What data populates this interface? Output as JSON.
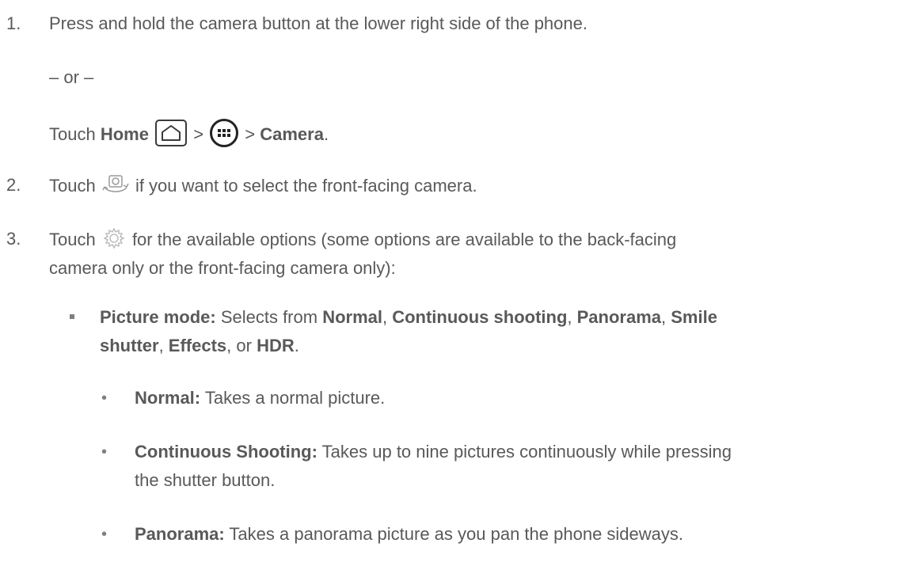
{
  "step1": {
    "num": "1.",
    "text": "Press and hold the camera button at the lower right side of the phone.",
    "or": "– or –",
    "touch": "Touch ",
    "home": "Home",
    "gt1": " > ",
    "gt2": " > ",
    "camera": "Camera",
    "period": "."
  },
  "step2": {
    "num": "2.",
    "touch": "Touch ",
    "rest": " if you want to select the front-facing camera."
  },
  "step3": {
    "num": "3.",
    "touch": "Touch ",
    "rest": " for the available options (some options are available to the back-facing",
    "line2": "camera only or the front-facing camera only):"
  },
  "picture_mode": {
    "label": "Picture mode:",
    "text1": " Selects from ",
    "normal": "Normal",
    "c1": ", ",
    "continuous": "Continuous shooting",
    "c2": ", ",
    "panorama": "Panorama",
    "c3": ", ",
    "smile": "Smile",
    "smile2": "shutter",
    "c4": ", ",
    "effects": "Effects",
    "c5": ", or ",
    "hdr": "HDR",
    "period": "."
  },
  "sub_items": [
    {
      "bullet": "•",
      "label": "Normal:",
      "text": " Takes a normal picture.",
      "text2": ""
    },
    {
      "bullet": "•",
      "label": "Continuous Shooting:",
      "text": " Takes up to nine pictures continuously while pressing",
      "text2": "the shutter button."
    },
    {
      "bullet": "•",
      "label": "Panorama:",
      "text": " Takes a panorama picture as you pan the phone sideways.",
      "text2": ""
    }
  ],
  "icons": {
    "home": "home-icon",
    "apps": "apps-icon",
    "switch_camera": "switch-camera-icon",
    "settings": "gear-icon"
  }
}
